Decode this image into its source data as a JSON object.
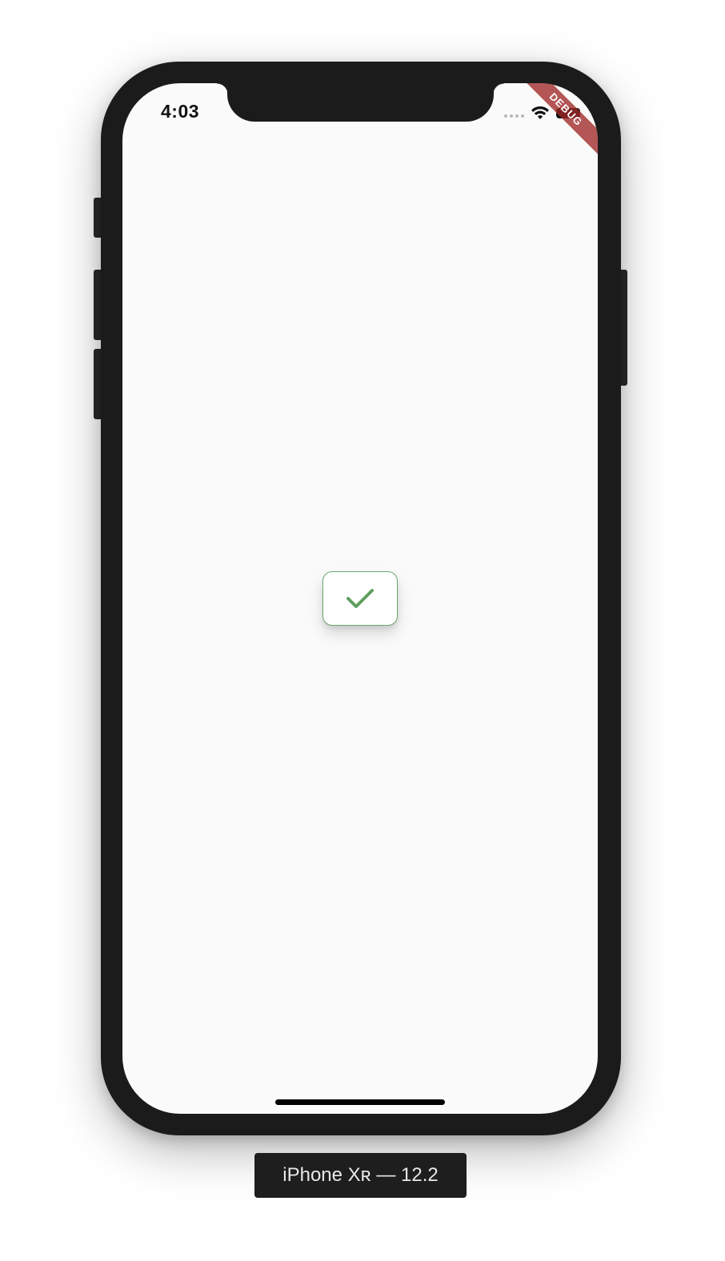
{
  "status_bar": {
    "time": "4:03",
    "debug_banner": "DEBUG"
  },
  "main": {
    "check_icon": "check-icon",
    "accent_color": "#5fa05f"
  },
  "device_label": "iPhone Xʀ — 12.2",
  "colors": {
    "frame": "#1b1b1b",
    "screen_bg": "#fafafa",
    "debug_ribbon": "#a02828"
  }
}
